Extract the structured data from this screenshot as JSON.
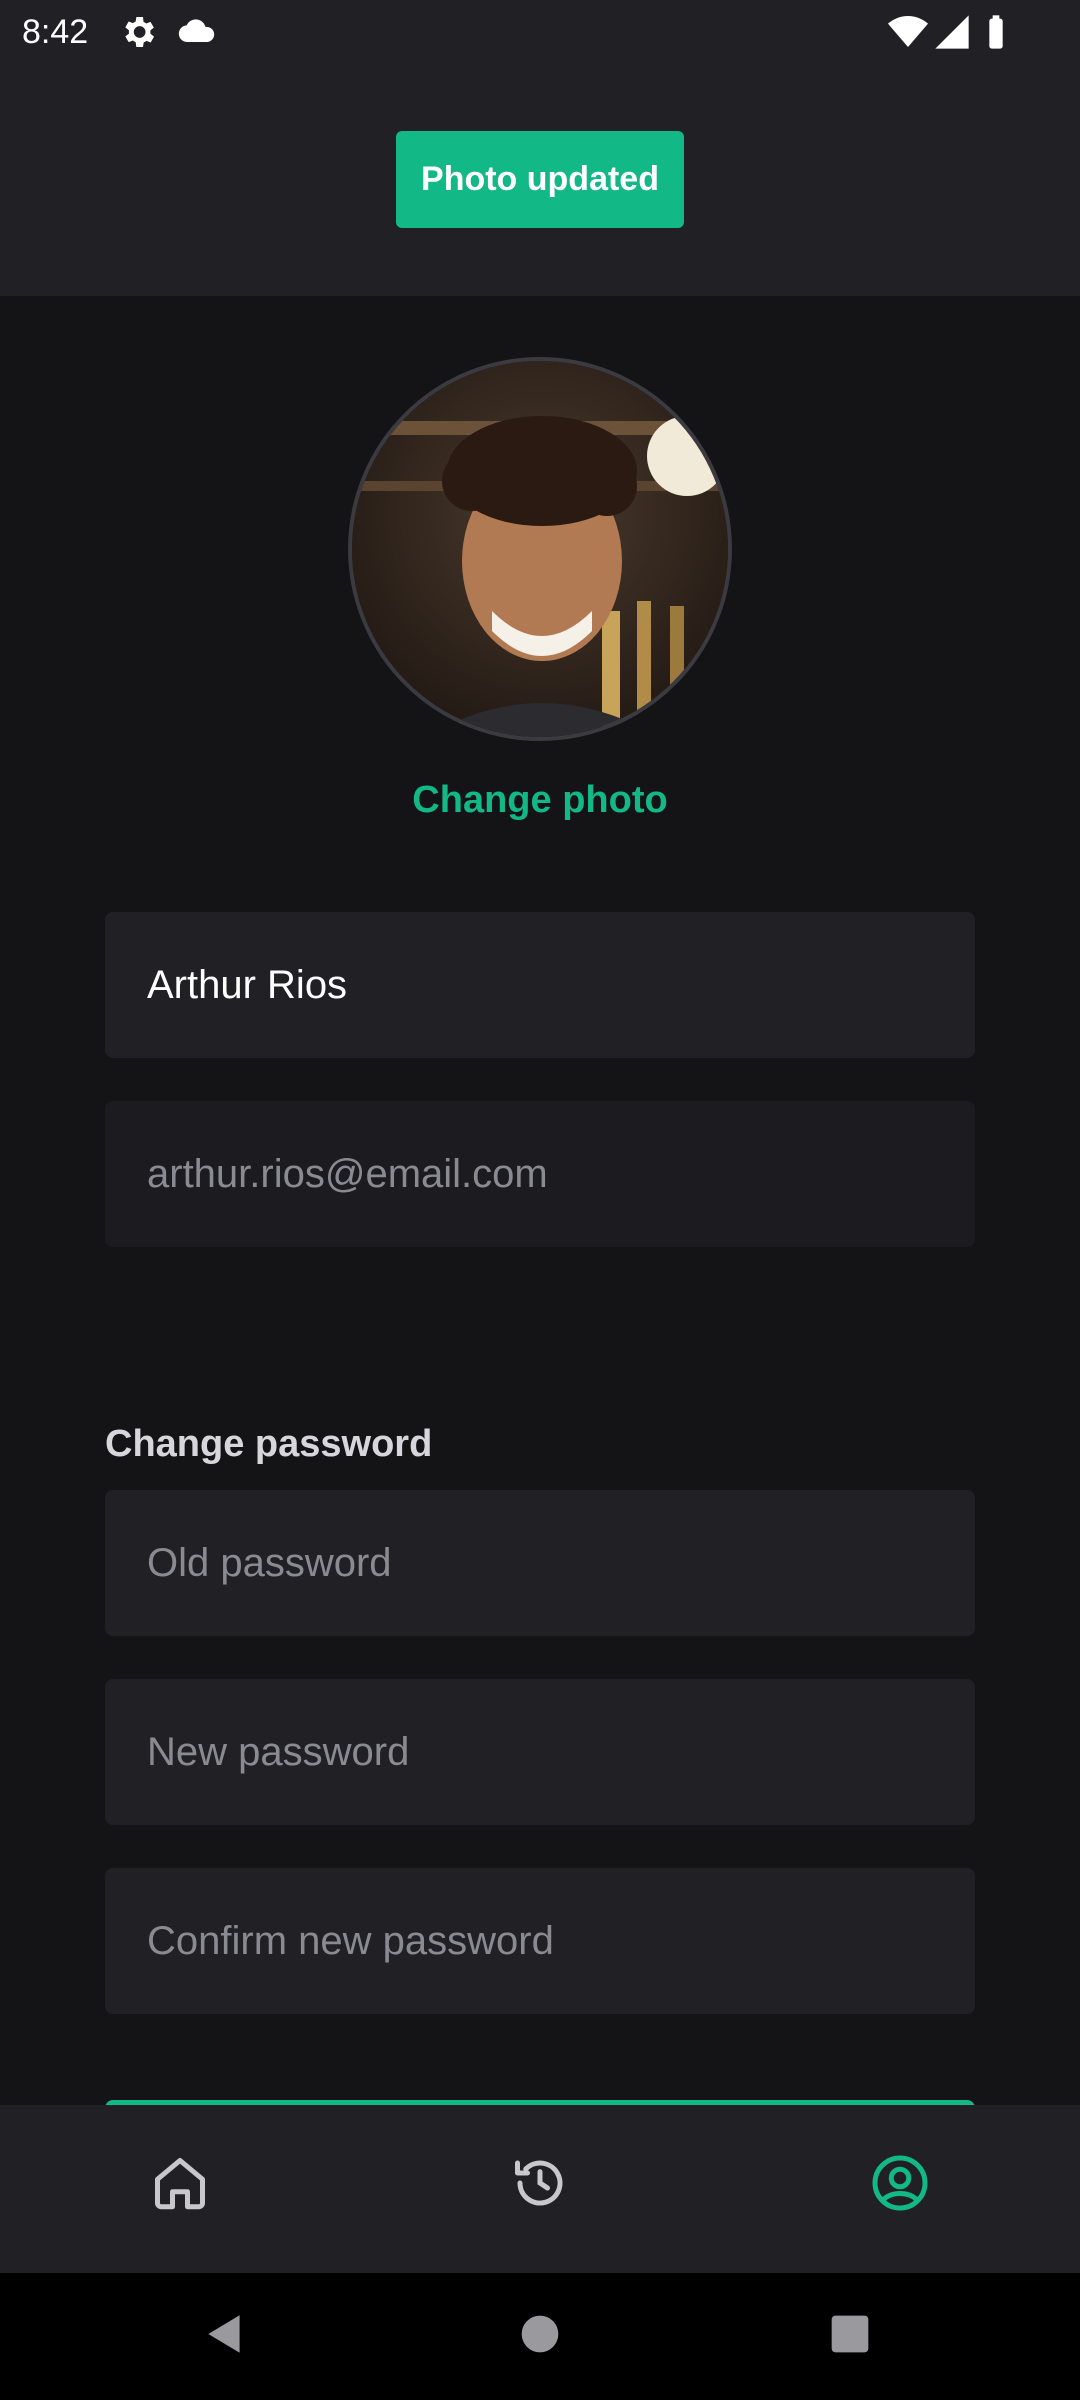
{
  "status_bar": {
    "time": "8:42",
    "left_icons": [
      "settings-icon",
      "cloud-icon"
    ],
    "right_icons": [
      "wifi-icon",
      "signal-icon",
      "battery-icon"
    ]
  },
  "toast": {
    "text": "Photo updated",
    "color": "#12b886"
  },
  "profile": {
    "change_photo_label": "Change photo",
    "name_value": "Arthur Rios",
    "email_placeholder": "arthur.rios@email.com"
  },
  "password": {
    "section_title": "Change password",
    "old_placeholder": "Old password",
    "new_placeholder": "New password",
    "confirm_placeholder": "Confirm new password"
  },
  "bottom_nav": {
    "items": [
      {
        "icon": "home-icon",
        "active": false
      },
      {
        "icon": "history-icon",
        "active": false
      },
      {
        "icon": "profile-icon",
        "active": true
      }
    ],
    "active_color": "#12b886"
  },
  "system_nav": [
    "back-icon",
    "home-circle-icon",
    "recents-icon"
  ],
  "colors": {
    "accent": "#12b886",
    "background": "#141417",
    "surface": "#212125"
  }
}
